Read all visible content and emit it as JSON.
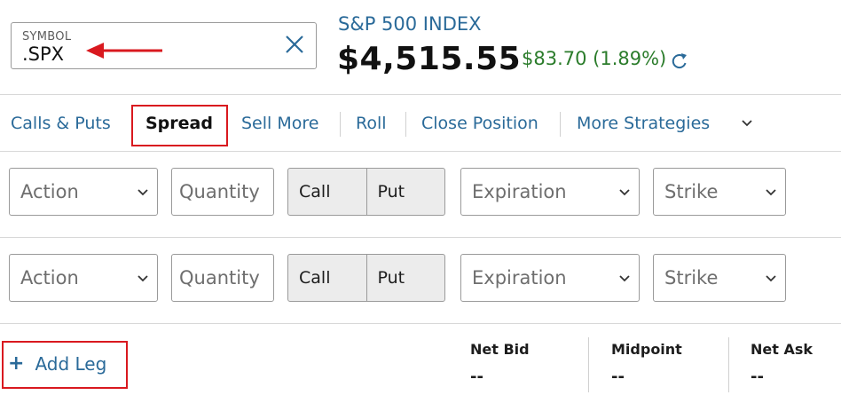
{
  "symbol": {
    "label": "SYMBOL",
    "value": ".SPX"
  },
  "quote": {
    "title": "S&P 500 INDEX",
    "price": "$4,515.55",
    "change": "$83.70 (1.89%)"
  },
  "tabs": [
    {
      "label": "Calls & Puts"
    },
    {
      "label": "Spread"
    },
    {
      "label": "Sell More"
    },
    {
      "label": "Roll"
    },
    {
      "label": "Close Position"
    },
    {
      "label": "More Strategies"
    }
  ],
  "legs": [
    {
      "action": "Action",
      "quantity": "Quantity",
      "call": "Call",
      "put": "Put",
      "expiration": "Expiration",
      "strike": "Strike"
    },
    {
      "action": "Action",
      "quantity": "Quantity",
      "call": "Call",
      "put": "Put",
      "expiration": "Expiration",
      "strike": "Strike"
    }
  ],
  "add_leg": "Add Leg",
  "metrics": [
    {
      "label": "Net Bid",
      "value": "--"
    },
    {
      "label": "Midpoint",
      "value": "--"
    },
    {
      "label": "Net Ask",
      "value": "--"
    }
  ],
  "colors": {
    "link": "#2a6a99",
    "positive": "#2b7c2b",
    "annotation": "#d9191f"
  },
  "icons": {
    "clear": "close-icon",
    "refresh": "refresh-icon",
    "dropdown": "chevron-down-icon",
    "add": "plus-icon",
    "annotation": "arrow-left-icon"
  }
}
